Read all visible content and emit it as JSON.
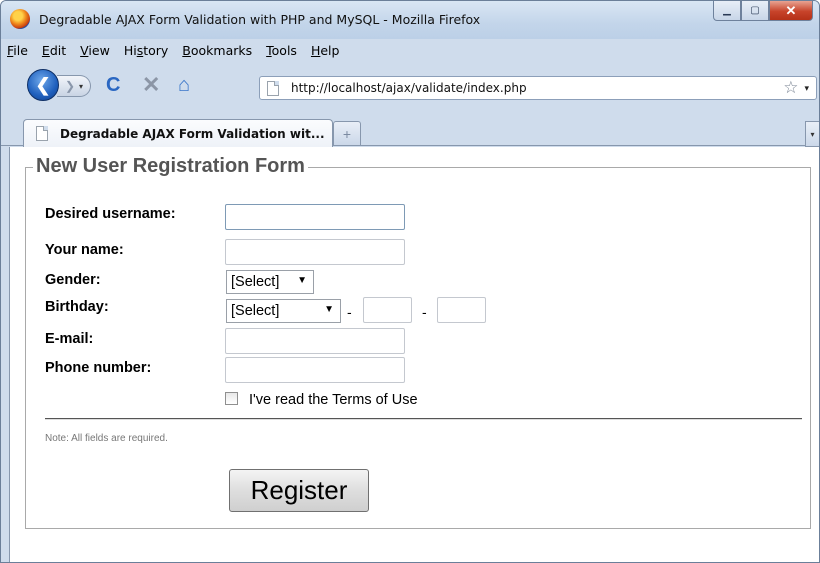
{
  "window": {
    "title": "Degradable AJAX Form Validation with PHP and MySQL - Mozilla Firefox",
    "minimize_icon": "minimize-icon",
    "maximize_icon": "maximize-icon",
    "close_icon": "close-icon"
  },
  "menubar": {
    "items": [
      {
        "first": "F",
        "rest": "ile"
      },
      {
        "first": "E",
        "rest": "dit"
      },
      {
        "first": "V",
        "rest": "iew"
      },
      {
        "pre": "Hi",
        "first": "s",
        "rest": "tory"
      },
      {
        "first": "B",
        "rest": "ookmarks"
      },
      {
        "first": "T",
        "rest": "ools"
      },
      {
        "first": "H",
        "rest": "elp"
      }
    ]
  },
  "navbar": {
    "url": "http://localhost/ajax/validate/index.php",
    "back_glyph": "❮",
    "forward_glyph": "❯",
    "reload_glyph": "C",
    "stop_glyph": "✕",
    "home_glyph": "⌂",
    "star_glyph": "☆",
    "drop_glyph": "▾"
  },
  "tabs": [
    {
      "label": "Degradable AJAX Form Validation wit...",
      "active": true
    }
  ],
  "newtab_glyph": "+",
  "form": {
    "legend": "New User Registration Form",
    "labels": {
      "username": "Desired username:",
      "name": "Your name:",
      "gender": "Gender:",
      "birthday": "Birthday:",
      "email": "E-mail:",
      "phone": "Phone number:"
    },
    "values": {
      "username": "",
      "name": "",
      "birthday_day": "",
      "birthday_year": "",
      "email": "",
      "phone": ""
    },
    "gender_select": "[Select]",
    "birthday_month_select": "[Select]",
    "dash": "-",
    "terms_label": "I've read the Terms of Use",
    "terms_checked": false,
    "note": "Note: All fields are required.",
    "submit_label": "Register"
  },
  "colors": {
    "legend_text": "#555555",
    "window_chrome": "#cfdcec",
    "close_button": "#c7432a"
  }
}
